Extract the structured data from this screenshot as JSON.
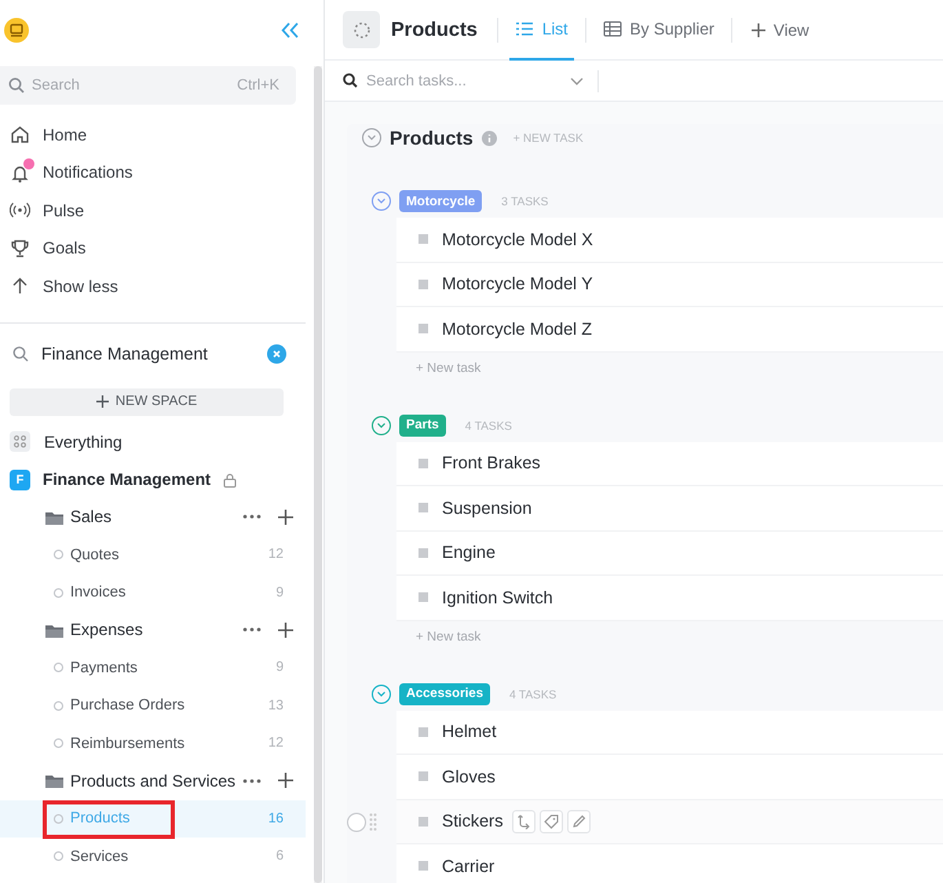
{
  "sidebar": {
    "search": {
      "placeholder": "Search",
      "shortcut": "Ctrl+K"
    },
    "nav": [
      {
        "kind": "home",
        "label": "Home",
        "unread": false
      },
      {
        "kind": "notifications",
        "label": "Notifications",
        "unread": true
      },
      {
        "kind": "pulse",
        "label": "Pulse",
        "unread": false
      },
      {
        "kind": "goals",
        "label": "Goals",
        "unread": false
      },
      {
        "kind": "less",
        "label": "Show less",
        "unread": false
      }
    ],
    "space_filter": {
      "value": "Finance Management"
    },
    "new_space": "NEW SPACE",
    "everything": "Everything",
    "space": {
      "initial": "F",
      "name": "Finance Management",
      "locked": true
    },
    "folders": [
      {
        "name": "Sales",
        "lists": [
          {
            "name": "Quotes",
            "count": "12",
            "selected": false,
            "marked": false
          },
          {
            "name": "Invoices",
            "count": "9",
            "selected": false,
            "marked": false
          }
        ]
      },
      {
        "name": "Expenses",
        "lists": [
          {
            "name": "Payments",
            "count": "9",
            "selected": false,
            "marked": false
          },
          {
            "name": "Purchase Orders",
            "count": "13",
            "selected": false,
            "marked": false
          },
          {
            "name": "Reimbursements",
            "count": "12",
            "selected": false,
            "marked": false
          }
        ]
      },
      {
        "name": "Products and Services",
        "lists": [
          {
            "name": "Products",
            "count": "16",
            "selected": true,
            "marked": true
          },
          {
            "name": "Services",
            "count": "6",
            "selected": false,
            "marked": false
          }
        ]
      }
    ]
  },
  "header": {
    "title": "Products",
    "tabs": [
      {
        "kind": "list",
        "label": "List",
        "selected": true
      },
      {
        "kind": "table",
        "label": "By Supplier",
        "selected": false
      }
    ],
    "add_view": "View"
  },
  "task_search": {
    "placeholder": "Search tasks..."
  },
  "list": {
    "title": "Products",
    "new_task": "+ NEW TASK",
    "groups": [
      {
        "name": "Motorcycle",
        "color": "#7f9ff2",
        "count": "3 TASKS",
        "new_task": "+ New task",
        "tasks": [
          {
            "name": "Motorcycle Model X",
            "hovered": false
          },
          {
            "name": "Motorcycle Model Y",
            "hovered": false
          },
          {
            "name": "Motorcycle Model Z",
            "hovered": false
          }
        ]
      },
      {
        "name": "Parts",
        "color": "#21b08b",
        "count": "4 TASKS",
        "new_task": "+ New task",
        "tasks": [
          {
            "name": "Front Brakes",
            "hovered": false
          },
          {
            "name": "Suspension",
            "hovered": false
          },
          {
            "name": "Engine",
            "hovered": false
          },
          {
            "name": "Ignition Switch",
            "hovered": false
          }
        ]
      },
      {
        "name": "Accessories",
        "color": "#16b3c6",
        "count": "4 TASKS",
        "tasks": [
          {
            "name": "Helmet",
            "hovered": false
          },
          {
            "name": "Gloves",
            "hovered": false
          },
          {
            "name": "Stickers",
            "hovered": true
          },
          {
            "name": "Carrier",
            "hovered": false
          }
        ]
      }
    ]
  }
}
